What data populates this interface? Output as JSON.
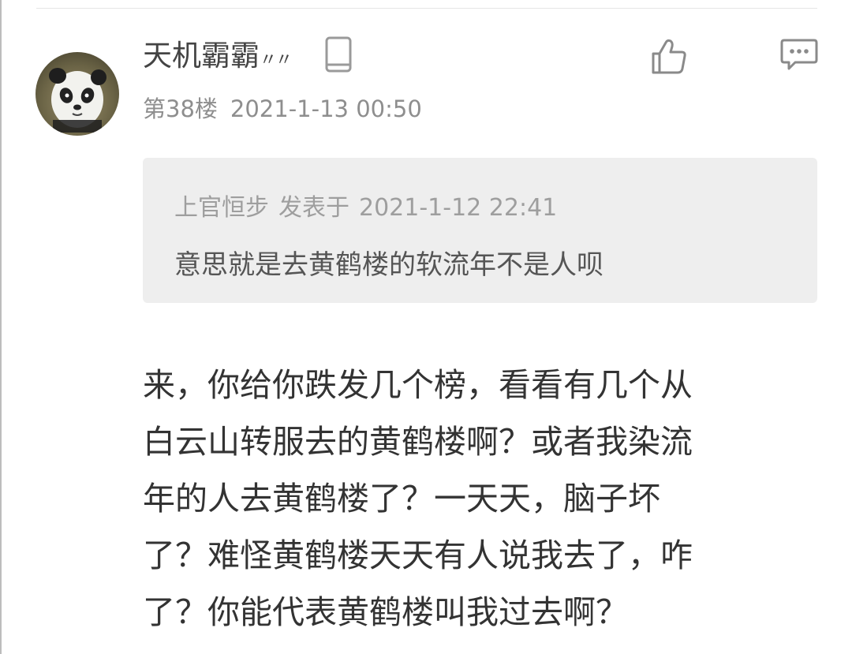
{
  "post": {
    "username": "天机霸霸",
    "username_suffix": "〃〃",
    "floor": "第38楼",
    "timestamp": "2021-1-13 00:50",
    "device_icon": "phone-icon",
    "like_icon": "thumbs-up-icon",
    "comment_icon": "comment-bubble-icon",
    "avatar_icon": "panda-avatar"
  },
  "quote": {
    "author": "上官恒步",
    "posted_label": "发表于",
    "timestamp": "2021-1-12 22:41",
    "text": "意思就是去黄鹤楼的软流年不是人呗"
  },
  "content": {
    "lines": [
      "来，你给你跌发几个榜，看看有几个从",
      "白云山转服去的黄鹤楼啊？或者我染流",
      "年的人去黄鹤楼了？一天天，脑子坏",
      "了？难怪黄鹤楼天天有人说我去了，咋",
      "了？你能代表黄鹤楼叫我过去啊？"
    ]
  },
  "colors": {
    "text_primary": "#333333",
    "text_secondary": "#8e8e8e",
    "quote_bg": "#eeeeee",
    "icon_gray": "#8a8a8a"
  }
}
